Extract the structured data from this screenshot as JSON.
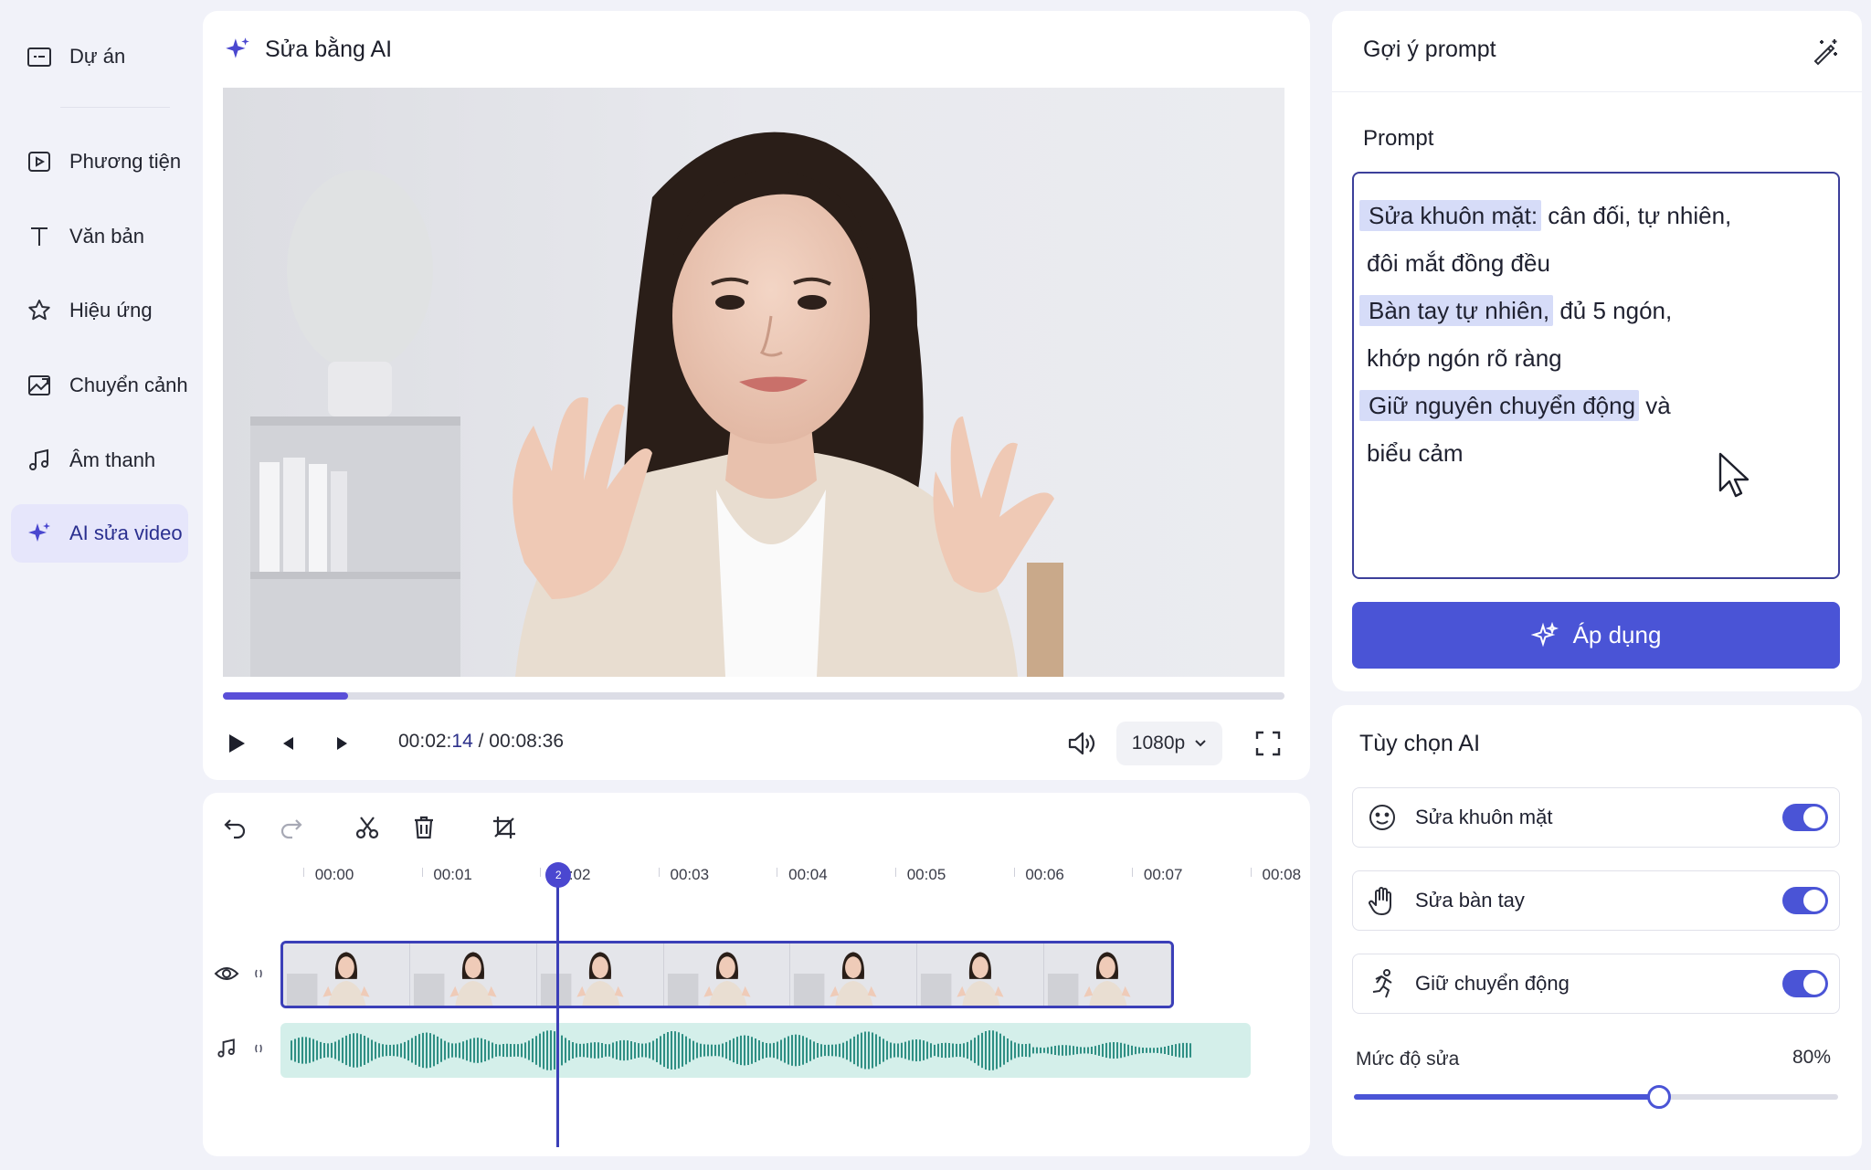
{
  "sidebar": {
    "items": [
      {
        "label": "Dự án",
        "icon": "folder-icon"
      },
      {
        "label": "Phương tiện",
        "icon": "media-icon"
      },
      {
        "label": "Văn bản",
        "icon": "text-icon"
      },
      {
        "label": "Hiệu ứng",
        "icon": "star-icon"
      },
      {
        "label": "Chuyển cảnh",
        "icon": "transition-icon"
      },
      {
        "label": "Âm thanh",
        "icon": "music-icon"
      },
      {
        "label": "AI sửa video",
        "icon": "sparkle-icon",
        "active": true
      }
    ]
  },
  "editor": {
    "title": "Sửa bằng AI",
    "progress": 0.118,
    "time_current_main": "00:02:",
    "time_current_frames": "14",
    "time_separator": " / ",
    "time_total": "00:08:36",
    "quality": "1080p"
  },
  "timeline": {
    "ticks": [
      "00:00",
      "00:01",
      "00:02",
      "00:03",
      "00:04",
      "00:05",
      "00:06",
      "00:07",
      "00:08"
    ],
    "playhead_seconds": 2,
    "playhead_label": "2"
  },
  "prompt_panel": {
    "header": "Gợi ý prompt",
    "label": "Prompt",
    "lines": [
      {
        "highlight": "Sửa khuôn mặt:",
        "rest": " cân đối, tự nhiên,"
      },
      {
        "highlight": "",
        "rest": "đôi mắt đồng đều"
      },
      {
        "highlight": "Bàn tay tự nhiên,",
        "rest": " đủ 5 ngón,"
      },
      {
        "highlight": "",
        "rest": "khớp ngón rõ ràng"
      },
      {
        "highlight": "Giữ nguyên chuyển động",
        "rest": " và"
      },
      {
        "highlight": "",
        "rest": "biểu cảm"
      }
    ],
    "apply_label": "Áp dụng"
  },
  "ai_options": {
    "title": "Tùy chọn AI",
    "options": [
      {
        "label": "Sửa khuôn mặt",
        "icon": "face-icon",
        "enabled": true
      },
      {
        "label": "Sửa bàn tay",
        "icon": "hand-icon",
        "enabled": true
      },
      {
        "label": "Giữ chuyển động",
        "icon": "running-icon",
        "enabled": true
      }
    ],
    "strength_label": "Mức độ sửa",
    "strength_value": "80%",
    "strength": 0.63
  },
  "colors": {
    "accent": "#4a54d6",
    "accent_dark": "#3b3fb8",
    "highlight": "#d6dcf8",
    "audio_wave": "#2f8f84",
    "audio_bg": "#d4efea"
  }
}
